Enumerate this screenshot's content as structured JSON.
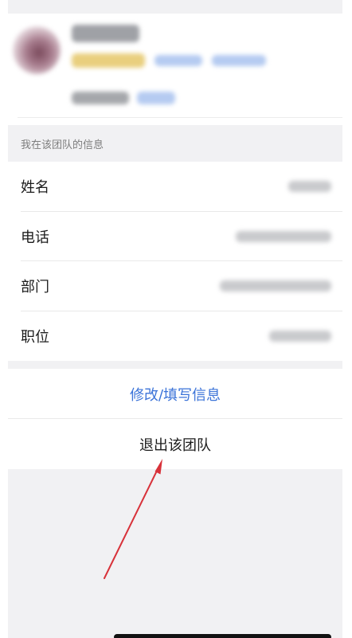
{
  "section": {
    "title": "我在该团队的信息"
  },
  "info": {
    "rows": [
      {
        "label": "姓名"
      },
      {
        "label": "电话"
      },
      {
        "label": "部门"
      },
      {
        "label": "职位"
      }
    ]
  },
  "actions": {
    "edit_label": "修改/填写信息",
    "quit_label": "退出该团队"
  },
  "colors": {
    "link_blue": "#3b73d8",
    "annotation_arrow": "#d8323a",
    "background": "#f1f1f3"
  },
  "icons": {
    "annotation": "arrow-pointer-icon"
  }
}
